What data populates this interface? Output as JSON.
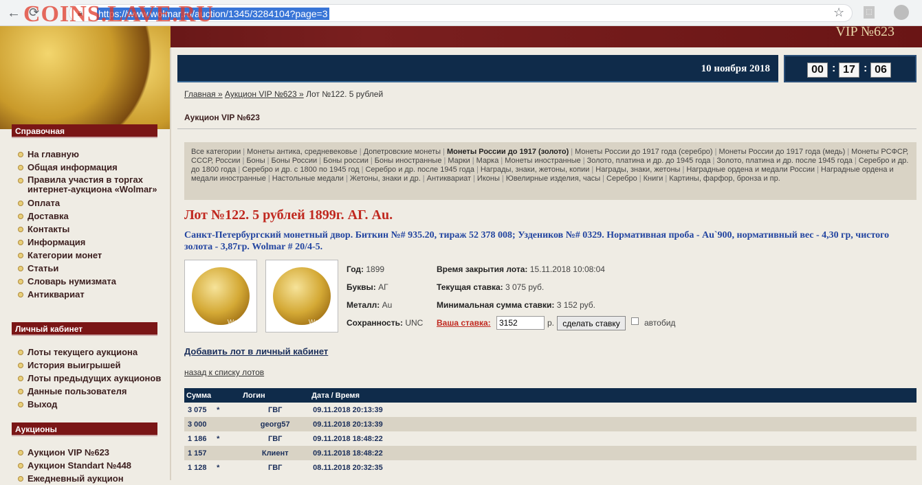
{
  "browser": {
    "url": "https://www.wolmar.ru/auction/1345/3284104?page=3",
    "watermark": "COINS.LAVE.RU"
  },
  "header": {
    "vip_title": "VIP №623"
  },
  "sidebar": {
    "sections": [
      {
        "title": "Справочная",
        "items": [
          "На главную",
          "Общая информация",
          "Правила участия в торгах интернет-аукциона «Wolmar»",
          "Оплата",
          "Доставка",
          "Контакты",
          "Информация",
          "Категории монет",
          "Статьи",
          "Словарь нумизмата",
          "Антиквариат"
        ]
      },
      {
        "title": "Личный кабинет",
        "items": [
          "Лоты текущего аукциона",
          "История выигрышей",
          "Лоты предыдущих аукционов",
          "Данные пользователя",
          "Выход"
        ]
      },
      {
        "title": "Аукционы",
        "items": [
          "Аукцион VIP №623",
          "Аукцион Standart №448",
          "Ежедневный аукцион"
        ]
      }
    ]
  },
  "datebar": {
    "date": "10 ноября 2018"
  },
  "timer": {
    "hh": "00",
    "mm": "17",
    "ss": "06"
  },
  "breadcrumb": {
    "home": "Главная »",
    "auction": "Аукцион VIP №623 »",
    "current": "Лот №122. 5 рублей"
  },
  "auction_heading": "Аукцион VIP №623",
  "categories": [
    "Все категории",
    "Монеты антика, средневековье",
    "Допетровские монеты",
    "Монеты России до 1917 (золото)",
    "Монеты России до 1917 года (серебро)",
    "Монеты России до 1917 года (медь)",
    "Монеты РСФСР, СССР, России",
    "Боны",
    "Боны России",
    "Боны россии",
    "Боны иностранные",
    "Марки",
    "Марка",
    "Монеты иностранные",
    "Золото, платина и др. до 1945 года",
    "Золото, платина и др. после 1945 года",
    "Серебро и др. до 1800 года",
    "Серебро и др. с 1800 по 1945 год",
    "Серебро и др. после 1945 года",
    "Награды, знаки, жетоны, копии",
    "Награды, знаки, жетоны",
    "Наградные ордена и медали России",
    "Наградные ордена и медали иностранные",
    "Настольные медали",
    "Жетоны, знаки и др.",
    "Антиквариат",
    "Иконы",
    "Ювелирные изделия, часы",
    "Серебро",
    "Книги",
    "Картины, фарфор, бронза и пр."
  ],
  "active_category": "Монеты России до 1917 (золото)",
  "lot": {
    "title": "Лот №122.  5 рублей 1899г. АГ. Au.",
    "description": "Санкт-Петербургский монетный двор. Биткин №# 935.20, тираж 52 378 008; Уздеников №# 0329. Нормативная проба - Au`900, нормативный вес - 4,30 гр, чистого золота - 3,87гр. Wolmar # 20/4-5.",
    "photo_mark": "Wolmar",
    "year_label": "Год:",
    "year": "1899",
    "letters_label": "Буквы:",
    "letters": "АГ",
    "metal_label": "Металл:",
    "metal": "Au",
    "grade_label": "Сохранность:",
    "grade": "UNC",
    "close_label": "Время закрытия лота:",
    "close_time": "15.11.2018 10:08:04",
    "current_label": "Текущая ставка:",
    "current_bid": "3 075 руб.",
    "min_label": "Минимальная сумма ставки:",
    "min_bid": "3 152 руб.",
    "your_bid_label": "Ваша ставка:",
    "your_bid_value": "3152",
    "currency_short": "р.",
    "bid_button": "сделать ставку",
    "autobid_label": "автобид"
  },
  "links": {
    "add_lot": "Добавить лот в личный кабинет",
    "back": "назад к списку лотов"
  },
  "bids_table": {
    "headers": [
      "Сумма",
      "",
      "Логин",
      "Дата / Время"
    ],
    "rows": [
      [
        "3 075",
        "*",
        "ГВГ",
        "09.11.2018 20:13:39"
      ],
      [
        "3 000",
        "",
        "georg57",
        "09.11.2018 20:13:39"
      ],
      [
        "1 186",
        "*",
        "ГВГ",
        "09.11.2018 18:48:22"
      ],
      [
        "1 157",
        "",
        "Клиент",
        "09.11.2018 18:48:22"
      ],
      [
        "1 128",
        "*",
        "ГВГ",
        "08.11.2018 20:32:35"
      ]
    ]
  }
}
